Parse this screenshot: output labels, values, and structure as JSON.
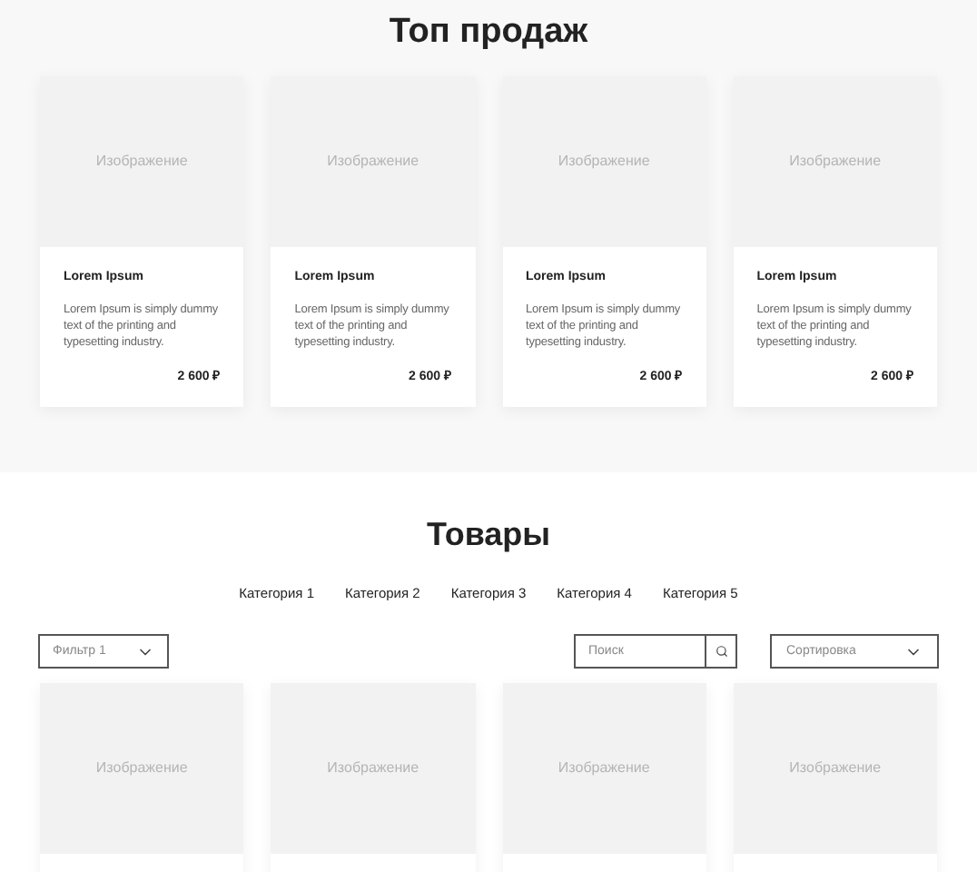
{
  "top_sales": {
    "title": "Топ продаж",
    "cards": [
      {
        "image_label": "Изображение",
        "name": "Lorem Ipsum",
        "description": "Lorem Ipsum is simply dummy text of the printing and typesetting industry.",
        "price": "2 600 ₽"
      },
      {
        "image_label": "Изображение",
        "name": "Lorem Ipsum",
        "description": "Lorem Ipsum is simply dummy text of the printing and typesetting industry.",
        "price": "2 600 ₽"
      },
      {
        "image_label": "Изображение",
        "name": "Lorem Ipsum",
        "description": "Lorem Ipsum is simply dummy text of the printing and typesetting industry.",
        "price": "2 600 ₽"
      },
      {
        "image_label": "Изображение",
        "name": "Lorem Ipsum",
        "description": "Lorem Ipsum is simply dummy text of the printing and typesetting industry.",
        "price": "2 600 ₽"
      }
    ]
  },
  "products": {
    "title": "Товары",
    "categories": [
      "Категория 1",
      "Категория 2",
      "Категория 3",
      "Категория 4",
      "Категория 5"
    ],
    "filter": {
      "value": "Фильтр 1"
    },
    "search": {
      "placeholder": "Поиск"
    },
    "sort": {
      "value": "Сортировка"
    },
    "cards": [
      {
        "image_label": "Изображение"
      },
      {
        "image_label": "Изображение"
      },
      {
        "image_label": "Изображение"
      },
      {
        "image_label": "Изображение"
      }
    ]
  }
}
